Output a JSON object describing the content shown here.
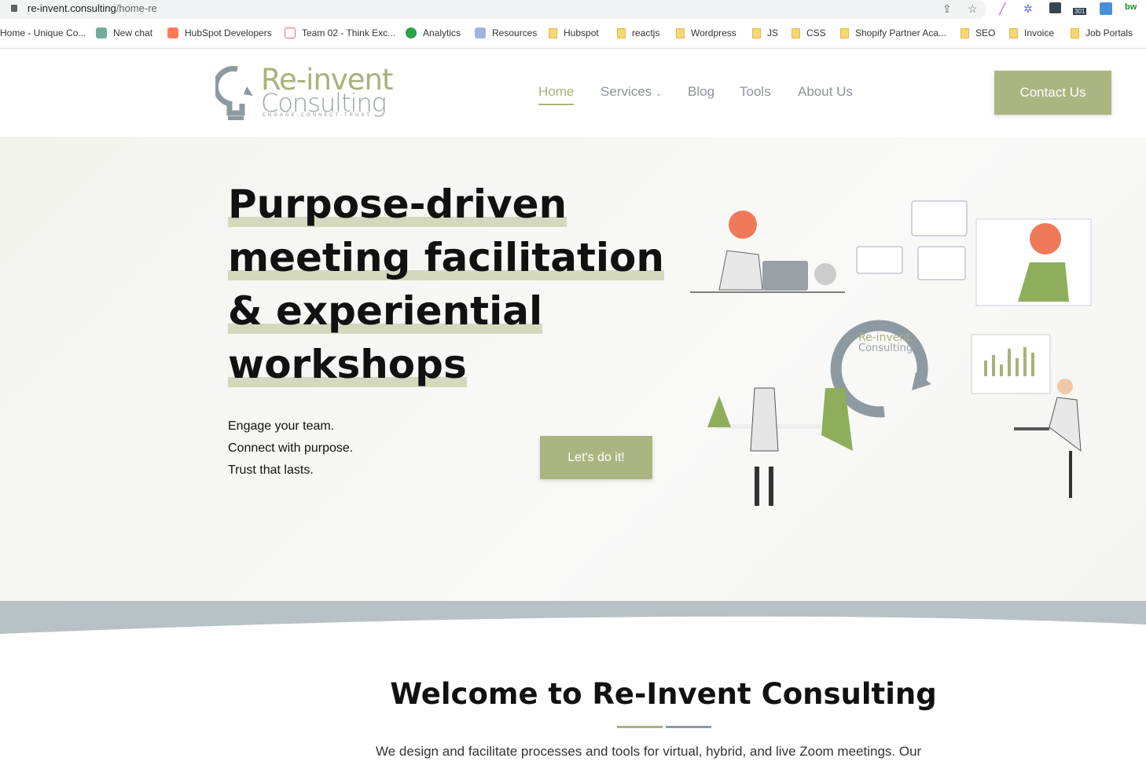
{
  "browser": {
    "url_host": "re-invent.consulting",
    "url_path": "/home-re",
    "bookmarks": [
      {
        "label": "Home - Unique Co...",
        "icon": "none"
      },
      {
        "label": "New chat",
        "icon": "chatgpt-icon"
      },
      {
        "label": "HubSpot Developers",
        "icon": "hubspot-icon"
      },
      {
        "label": "Team 02 - Think Exc...",
        "icon": "house-icon"
      },
      {
        "label": "Analytics",
        "icon": "analytics-icon"
      },
      {
        "label": "Resources",
        "icon": "resources-icon"
      },
      {
        "label": "Hubspot",
        "icon": "folder-icon"
      },
      {
        "label": "reactjs",
        "icon": "folder-icon"
      },
      {
        "label": "Wordpress",
        "icon": "folder-icon"
      },
      {
        "label": "JS",
        "icon": "folder-icon"
      },
      {
        "label": "CSS",
        "icon": "folder-icon"
      },
      {
        "label": "Shopify Partner Aca...",
        "icon": "folder-icon"
      },
      {
        "label": "SEO",
        "icon": "folder-icon"
      },
      {
        "label": "Invoice",
        "icon": "folder-icon"
      },
      {
        "label": "Job Portals",
        "icon": "folder-icon"
      }
    ],
    "extension_badge": "301",
    "extension_text": "bw"
  },
  "logo": {
    "line1": "Re-invent",
    "line2": "Consulting",
    "tagline": "ENGAGE-CONNECT-TRUST"
  },
  "nav": {
    "items": [
      "Home",
      "Services",
      "Blog",
      "Tools",
      "About Us"
    ],
    "active": "Home",
    "contact": "Contact Us"
  },
  "hero": {
    "title_lines": [
      "Purpose-driven",
      "meeting facilitation",
      "& experiential",
      "workshops"
    ],
    "sub_lines": [
      "Engage your team.",
      "Connect with purpose.",
      "Trust that lasts."
    ],
    "cta": "Let's do it!",
    "illustration_logo": [
      "Re-invent",
      "Consulting"
    ]
  },
  "welcome": {
    "title": "Welcome to Re-Invent Consulting",
    "intro": "We design and facilitate processes and tools for virtual, hybrid, and live Zoom meetings. Our"
  },
  "colors": {
    "accent": "#abb582",
    "gray": "#9aa3a9",
    "band": "#b8c1c5"
  }
}
